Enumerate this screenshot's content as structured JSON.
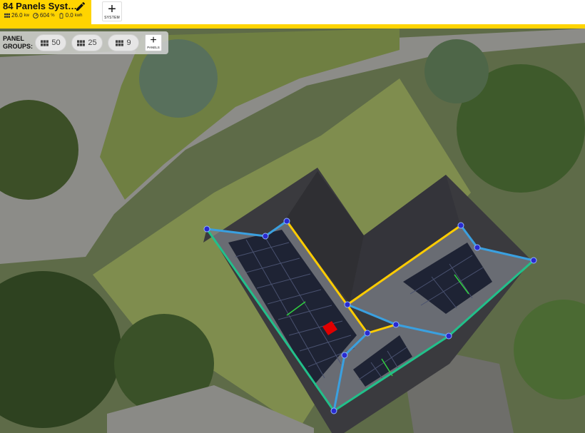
{
  "project": {
    "title": "84 Panels Syst…",
    "capacity": "26.0",
    "capacity_unit": "kw",
    "ratio": "604",
    "ratio_unit": "%",
    "storage": "0.0",
    "storage_unit": "kwh"
  },
  "toolbar": {
    "system_label": "SYSTEM"
  },
  "panel_groups": {
    "label": "PANEL GROUPS:",
    "groups": [
      {
        "count": "50"
      },
      {
        "count": "25"
      },
      {
        "count": "9"
      }
    ],
    "add_label": "PANELS"
  },
  "colors": {
    "accent": "#ffd400",
    "edge_blue": "#3aa0e0",
    "edge_yellow": "#ffcc00",
    "edge_green": "#22c08a",
    "vertex": "#2a2ad0",
    "obstruction": "#e00000"
  }
}
